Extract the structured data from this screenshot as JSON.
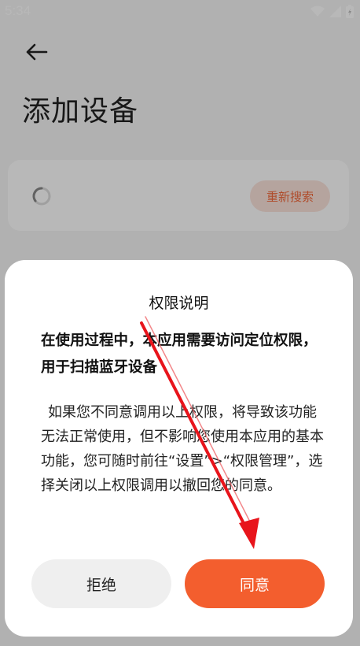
{
  "status_bar": {
    "time": "5:34"
  },
  "header": {
    "title": "添加设备"
  },
  "search_card": {
    "research_label": "重新搜索"
  },
  "dialog": {
    "title": "权限说明",
    "subtitle": "在使用过程中，本应用需要访问定位权限，用于扫描蓝牙设备",
    "body": "如果您不同意调用以上权限，将导致该功能无法正常使用，但不影响您使用本应用的基本功能，您可随时前往“设置”>“权限管理”，选择关闭以上权限调用以撤回您的同意。",
    "reject_label": "拒绝",
    "agree_label": "同意"
  },
  "colors": {
    "accent": "#f35e2e",
    "accent_light": "#fbe3dc",
    "annotation": "#e8141b"
  },
  "icons": [
    "back-arrow-icon",
    "loading-spinner-icon",
    "wifi-icon",
    "signal-icon",
    "battery-icon"
  ]
}
